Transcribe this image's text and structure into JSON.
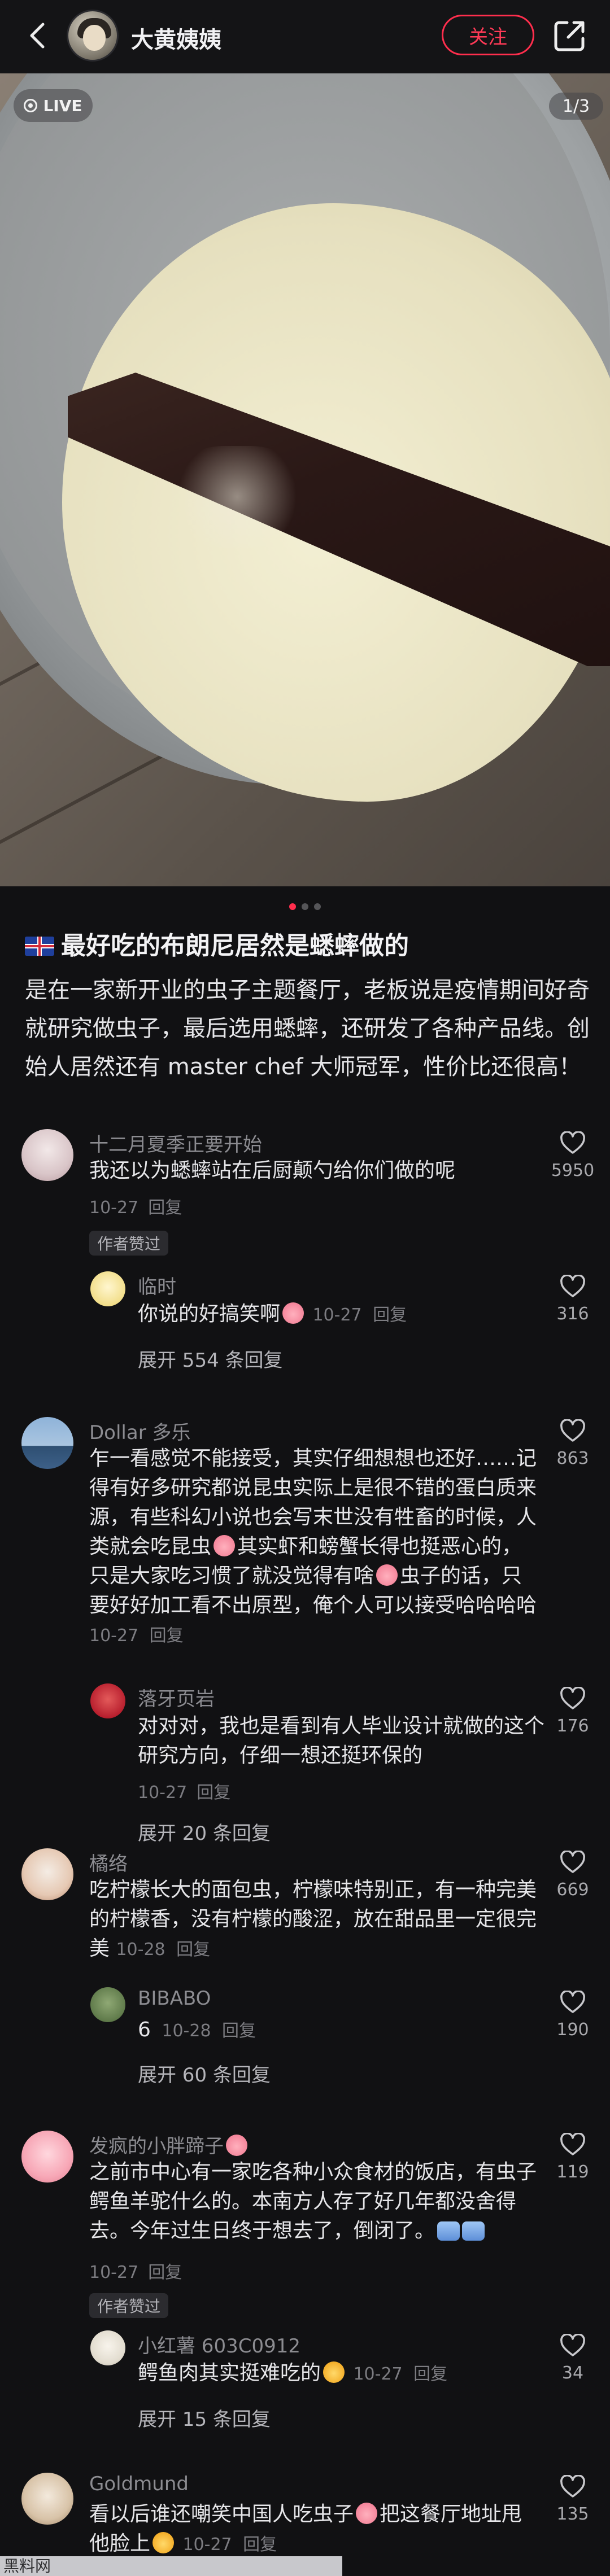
{
  "header": {
    "author_name": "大黄姨姨",
    "follow_label": "关注"
  },
  "photo": {
    "live_label": "LIVE",
    "page_counter": "1/3"
  },
  "post": {
    "title": "最好吃的布朗尼居然是蟋蟀做的",
    "body": "是在一家新开业的虫子主题餐厅，老板说是疫情期间好奇就研究做虫子，最后选用蟋蟀，还研发了各种产品线。创始人居然还有 master chef 大师冠军，性价比还很高！"
  },
  "comments": [
    {
      "name": "十二月夏季正要开始",
      "text": "我还以为蟋蟀站在后厨颠勺给你们做的呢",
      "date": "10-27",
      "reply_label": "回复",
      "likes": "5950",
      "author_liked": "作者赞过",
      "replies": [
        {
          "name": "临时",
          "text": "你说的好搞笑啊",
          "date": "10-27",
          "reply_label": "回复",
          "likes": "316"
        }
      ],
      "expand": "展开 554 条回复"
    },
    {
      "name": "Dollar 多乐",
      "text": "乍一看感觉不能接受，其实仔细想想也还好……记得有好多研究都说昆虫实际上是很不错的蛋白质来源，有些科幻小说也会写末世没有牲畜的时候，人类就会吃昆虫",
      "text2": "其实虾和螃蟹长得也挺恶心的，只是大家吃习惯了就没觉得有啥",
      "text3": "虫子的话，只要好好加工看不出原型，俺个人可以接受哈哈哈哈",
      "date": "10-27",
      "reply_label": "回复",
      "likes": "863",
      "replies": [
        {
          "name": "落牙页岩",
          "text": "对对对，我也是看到有人毕业设计就做的这个研究方向，仔细一想还挺环保的",
          "date": "10-27",
          "reply_label": "回复",
          "likes": "176"
        }
      ],
      "expand": "展开 20 条回复"
    },
    {
      "name": "橘络",
      "text": "吃柠檬长大的面包虫，柠檬味特别正，有一种完美的柠檬香，没有柠檬的酸涩，放在甜品里一定很完美",
      "date": "10-28",
      "reply_label": "回复",
      "likes": "669",
      "replies": [
        {
          "name": "BIBABO",
          "text": "6",
          "date": "10-28",
          "reply_label": "回复",
          "likes": "190"
        }
      ],
      "expand": "展开 60 条回复"
    },
    {
      "name": "发疯的小胖蹄子",
      "text": "之前市中心有一家吃各种小众食材的饭店，有虫子鳄鱼羊驼什么的。本南方人存了好几年都没舍得去。今年过生日终于想去了，倒闭了。",
      "date": "10-27",
      "reply_label": "回复",
      "likes": "119",
      "author_liked": "作者赞过",
      "replies": [
        {
          "name": "小红薯 603C0912",
          "text": "鳄鱼肉其实挺难吃的",
          "date": "10-27",
          "reply_label": "回复",
          "likes": "34"
        }
      ],
      "expand": "展开 15 条回复"
    },
    {
      "name": "Goldmund",
      "text": "看以后谁还嘲笑中国人吃虫子",
      "text2": "把这餐厅地址甩他脸上",
      "date": "10-27",
      "reply_label": "回复",
      "likes": "135"
    }
  ],
  "watermark": "黑料网"
}
